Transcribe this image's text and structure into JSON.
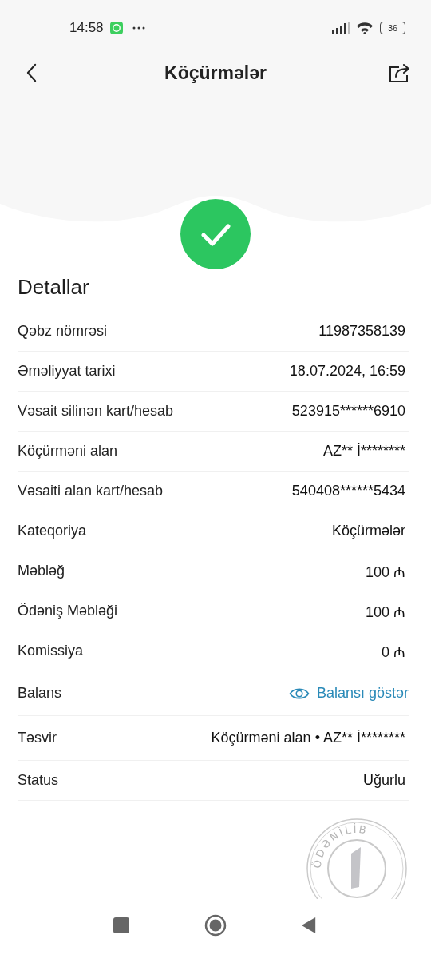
{
  "status_bar": {
    "time": "14:58",
    "battery": "36"
  },
  "header": {
    "title": "Köçürmələr"
  },
  "section_title": "Detallar",
  "rows": [
    {
      "kind": "text",
      "label": "Qəbz nömrəsi",
      "value": "11987358139"
    },
    {
      "kind": "text",
      "label": "Əməliyyat tarixi",
      "value": "18.07.2024, 16:59"
    },
    {
      "kind": "text",
      "label": "Vəsait silinən kart/hesab",
      "value": "523915******6910"
    },
    {
      "kind": "text",
      "label": "Köçürməni alan",
      "value": "AZ** İ********"
    },
    {
      "kind": "text",
      "label": "Vəsaiti alan kart/hesab",
      "value": "540408******5434"
    },
    {
      "kind": "text",
      "label": "Kateqoriya",
      "value": "Köçürmələr"
    },
    {
      "kind": "text",
      "label": "Məbləğ",
      "value": "100 ₼"
    },
    {
      "kind": "text",
      "label": "Ödəniş Məbləği",
      "value": "100 ₼"
    },
    {
      "kind": "text",
      "label": "Komissiya",
      "value": "0 ₼"
    },
    {
      "kind": "link",
      "label": "Balans",
      "value": "Balansı göstər"
    },
    {
      "kind": "text",
      "label": "Təsvir",
      "value": "Köçürməni alan • AZ** İ********"
    },
    {
      "kind": "text",
      "label": "Status",
      "value": "Uğurlu"
    }
  ],
  "stamp": {
    "text": "ÖDƏNİLİB"
  }
}
